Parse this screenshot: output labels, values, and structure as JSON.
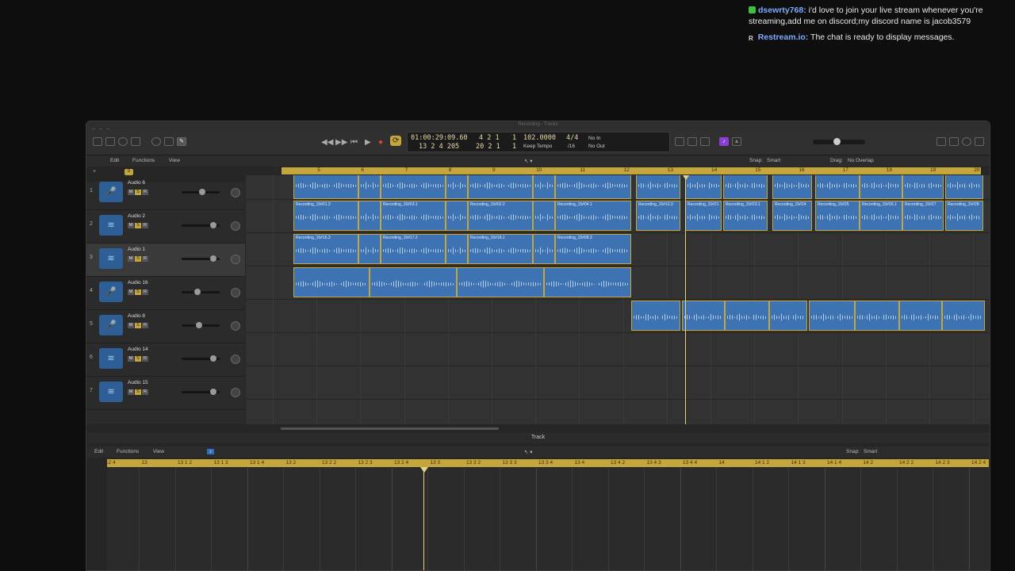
{
  "chat": {
    "messages": [
      {
        "user": "dsewrty768:",
        "text": "i'd love to join your live stream whenever you're streaming,add me on discord;my discord name is jacob3579"
      },
      {
        "user": "Restream.io:",
        "text": "The chat is ready to display messages."
      }
    ]
  },
  "window": {
    "title": "Recording - Tracks"
  },
  "lcd": {
    "time": "01:00:29:09.60",
    "smpte": "13  2  4  205",
    "pos1": "4  2  1",
    "pos1b": "1",
    "pos2": "20  2  1",
    "pos2b": "1",
    "tempo": "102.0000",
    "tempo_mode": "Keep Tempo",
    "sig": "4/4",
    "div": "/16",
    "in": "No In",
    "out": "No Out"
  },
  "arrange_bar": {
    "edit": "Edit",
    "functions": "Functions",
    "view": "View",
    "snap_label": "Snap:",
    "snap_value": "Smart",
    "drag_label": "Drag:",
    "drag_value": "No Overlap"
  },
  "ruler": [
    "4",
    "5",
    "6",
    "7",
    "8",
    "9",
    "10",
    "11",
    "12",
    "13",
    "14",
    "15",
    "16",
    "17",
    "18",
    "19",
    "20"
  ],
  "tracks": [
    {
      "num": "1",
      "name": "Audio 6",
      "icon": "mic-icon",
      "fader": 0.55
    },
    {
      "num": "2",
      "name": "Audio 2",
      "icon": "waveform-icon",
      "fader": 0.9
    },
    {
      "num": "3",
      "name": "Audio 1",
      "icon": "waveform-icon",
      "fader": 0.9
    },
    {
      "num": "4",
      "name": "Audio 16",
      "icon": "mic-icon",
      "fader": 0.4
    },
    {
      "num": "5",
      "name": "Audio 8",
      "icon": "mic-icon",
      "fader": 0.45
    },
    {
      "num": "6",
      "name": "Audio 14",
      "icon": "waveform-icon",
      "fader": 0.9
    },
    {
      "num": "7",
      "name": "Audio 15",
      "icon": "waveform-icon",
      "fader": 0.9
    }
  ],
  "regions_row2": [
    "Recording_15#01.3",
    "Recording_15#03.1",
    "Recording_15#02.2",
    "Recording_15#04.1",
    "Recording_15#10.3",
    "Recording_15#21",
    "Recording_15#23.1",
    "Recording_15#24",
    "Recording_15#25",
    "Recording_15#26.1",
    "Recording_15#27",
    "Recording_15#28"
  ],
  "regions_row3": [
    "Recording_15#16.3",
    "Recording_15#17.2",
    "Recording_15#18.1",
    "Recording_15#08.3"
  ],
  "editor": {
    "title": "Track",
    "edit": "Edit",
    "functions": "Functions",
    "view": "View",
    "snap_label": "Snap:",
    "snap_value": "Smart",
    "ruler": [
      "12 4",
      "13",
      "13 1 2",
      "13 1 3",
      "13 1 4",
      "13 2",
      "13 2 2",
      "13 2 3",
      "13 2 4",
      "13 3",
      "13 3 2",
      "13 3 3",
      "13 3 4",
      "13 4",
      "13 4 2",
      "13 4 3",
      "13 4 4",
      "14",
      "14 1 2",
      "14 1 3",
      "14 1 4",
      "14 2",
      "14 2 2",
      "14 2 3",
      "14 2 4"
    ]
  },
  "colors": {
    "accent": "#c4a63c",
    "region": "#3d72b3",
    "playhead": "#e6d28a"
  }
}
